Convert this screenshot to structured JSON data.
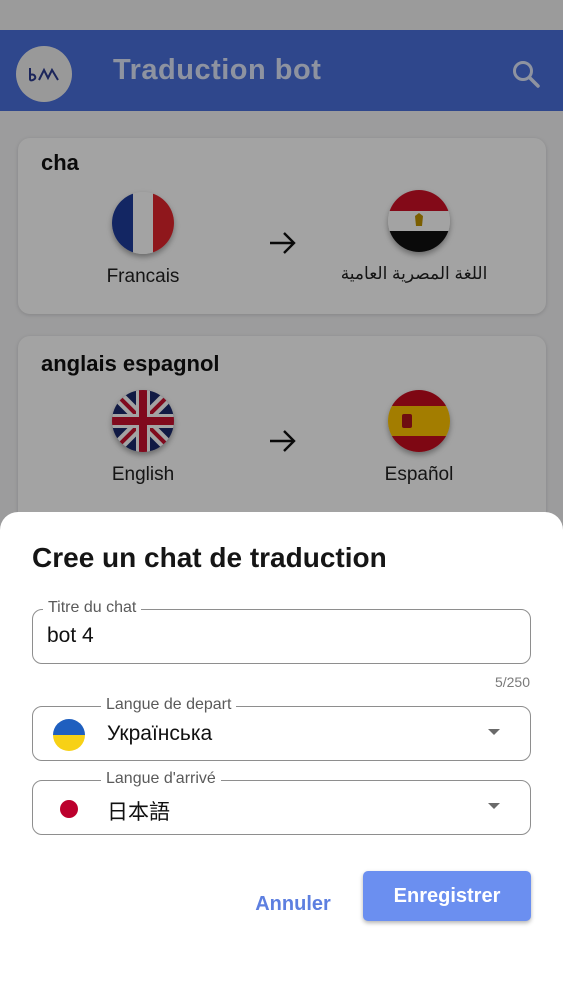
{
  "app": {
    "title": "Traduction bot",
    "logo_text": "bM",
    "brand_color": "#4a6fdc"
  },
  "chats": [
    {
      "name": "cha",
      "from_label": "Francais",
      "from_flag": "france-flag-icon",
      "to_label": "اللغة المصرية العامية",
      "to_flag": "egypt-flag-icon"
    },
    {
      "name": "anglais espagnol",
      "from_label": "English",
      "from_flag": "uk-flag-icon",
      "to_label": "Español",
      "to_flag": "spain-flag-icon"
    }
  ],
  "sheet": {
    "title": "Cree un chat de traduction",
    "title_field": {
      "label": "Titre du chat",
      "value": "bot 4",
      "counter": "5/250"
    },
    "from_field": {
      "label": "Langue de depart",
      "value": "Українська",
      "flag": "ukraine-flag-icon"
    },
    "to_field": {
      "label": "Langue d'arrivé",
      "value": "日本語",
      "flag": "japan-flag-icon"
    },
    "cancel_label": "Annuler",
    "save_label": "Enregistrer",
    "accent_color": "#6b8ff0"
  }
}
